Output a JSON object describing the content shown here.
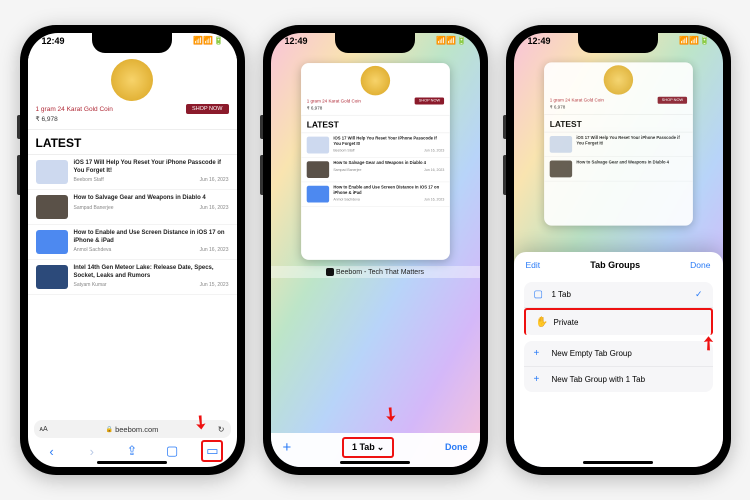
{
  "status": {
    "time": "12:49",
    "indicators": "📶 📶 🔋"
  },
  "hero": {
    "title": "1 gram 24 Karat Gold Coin",
    "price": "₹ 6,978",
    "cta": "SHOP NOW"
  },
  "latest_heading": "LATEST",
  "articles": [
    {
      "title": "iOS 17 Will Help You Reset Your iPhone Passcode if You Forget It!",
      "author": "Beebom Staff",
      "date": "Jun 16, 2023"
    },
    {
      "title": "How to Salvage Gear and Weapons in Diablo 4",
      "author": "Sampad Banerjee",
      "date": "Jun 16, 2023"
    },
    {
      "title": "How to Enable and Use Screen Distance in iOS 17 on iPhone & iPad",
      "author": "Anmol Sachdeva",
      "date": "Jun 16, 2023"
    },
    {
      "title": "Intel 14th Gen Meteor Lake: Release Date, Specs, Socket, Leaks and Rumors",
      "author": "Satyam Kumar",
      "date": "Jun 15, 2023"
    }
  ],
  "url": {
    "aa": "ᴀA",
    "lock": "🔒",
    "host": "beebom.com",
    "reload": "↻"
  },
  "toolbar": {
    "back": "‹",
    "fwd": "›",
    "share": "⇪",
    "bookmarks": "▢",
    "tabs": "▭"
  },
  "tabview": {
    "caption": "Beebom - Tech That Matters",
    "plus": "+",
    "count": "1 Tab",
    "chev": "⌄",
    "done": "Done"
  },
  "sheet": {
    "edit": "Edit",
    "title": "Tab Groups",
    "done": "Done",
    "row1": {
      "icon": "▢",
      "label": "1 Tab"
    },
    "row2": {
      "icon": "✋",
      "label": "Private"
    },
    "row3": {
      "icon": "+",
      "label": "New Empty Tab Group"
    },
    "row4": {
      "icon": "+",
      "label": "New Tab Group with 1 Tab"
    }
  }
}
